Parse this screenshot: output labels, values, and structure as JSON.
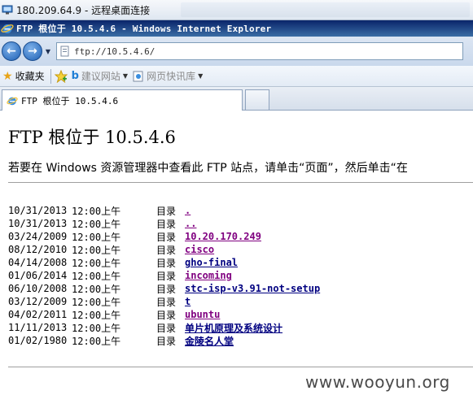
{
  "rdp": {
    "title": "180.209.64.9 - 远程桌面连接"
  },
  "window": {
    "title": "FTP 根位于 10.5.4.6 - Windows Internet Explorer"
  },
  "address": {
    "url": "ftp://10.5.4.6/"
  },
  "favorites": {
    "label": "收藏夹",
    "items": [
      {
        "label": "建议网站"
      },
      {
        "label": "网页快讯库"
      }
    ]
  },
  "tab": {
    "title": "FTP 根位于 10.5.4.6"
  },
  "page": {
    "heading": "FTP 根位于 10.5.4.6",
    "instructions": "若要在 Windows 资源管理器中查看此 FTP 站点，请单击“页面”，然后单击“在"
  },
  "listing": [
    {
      "date": "10/31/2013",
      "time": "12:00上午",
      "type": "目录",
      "name": ".",
      "visited": true
    },
    {
      "date": "10/31/2013",
      "time": "12:00上午",
      "type": "目录",
      "name": "..",
      "visited": true
    },
    {
      "date": "03/24/2009",
      "time": "12:00上午",
      "type": "目录",
      "name": "10.20.170.249",
      "visited": true
    },
    {
      "date": "08/12/2010",
      "time": "12:00上午",
      "type": "目录",
      "name": "cisco",
      "visited": true
    },
    {
      "date": "04/14/2008",
      "time": "12:00上午",
      "type": "目录",
      "name": "gho-final",
      "visited": false
    },
    {
      "date": "01/06/2014",
      "time": "12:00上午",
      "type": "目录",
      "name": "incoming",
      "visited": true
    },
    {
      "date": "06/10/2008",
      "time": "12:00上午",
      "type": "目录",
      "name": "stc-isp-v3.91-not-setup",
      "visited": false
    },
    {
      "date": "03/12/2009",
      "time": "12:00上午",
      "type": "目录",
      "name": "t",
      "visited": false
    },
    {
      "date": "04/02/2011",
      "time": "12:00上午",
      "type": "目录",
      "name": "ubuntu",
      "visited": true
    },
    {
      "date": "11/11/2013",
      "time": "12:00上午",
      "type": "目录",
      "name": "单片机原理及系统设计",
      "visited": false
    },
    {
      "date": "01/02/1980",
      "time": "12:00上午",
      "type": "目录",
      "name": "金陵名人堂",
      "visited": false
    }
  ],
  "watermark": {
    "text": "www.wooyun.org"
  },
  "icons": {
    "rdp": "remote-desktop-icon",
    "ie": "internet-explorer-icon",
    "back": "back-arrow-icon",
    "forward": "forward-arrow-icon",
    "favorites": "star-icon",
    "add_favorite": "add-favorite-icon",
    "bing": "bing-icon",
    "page": "web-slice-icon"
  }
}
